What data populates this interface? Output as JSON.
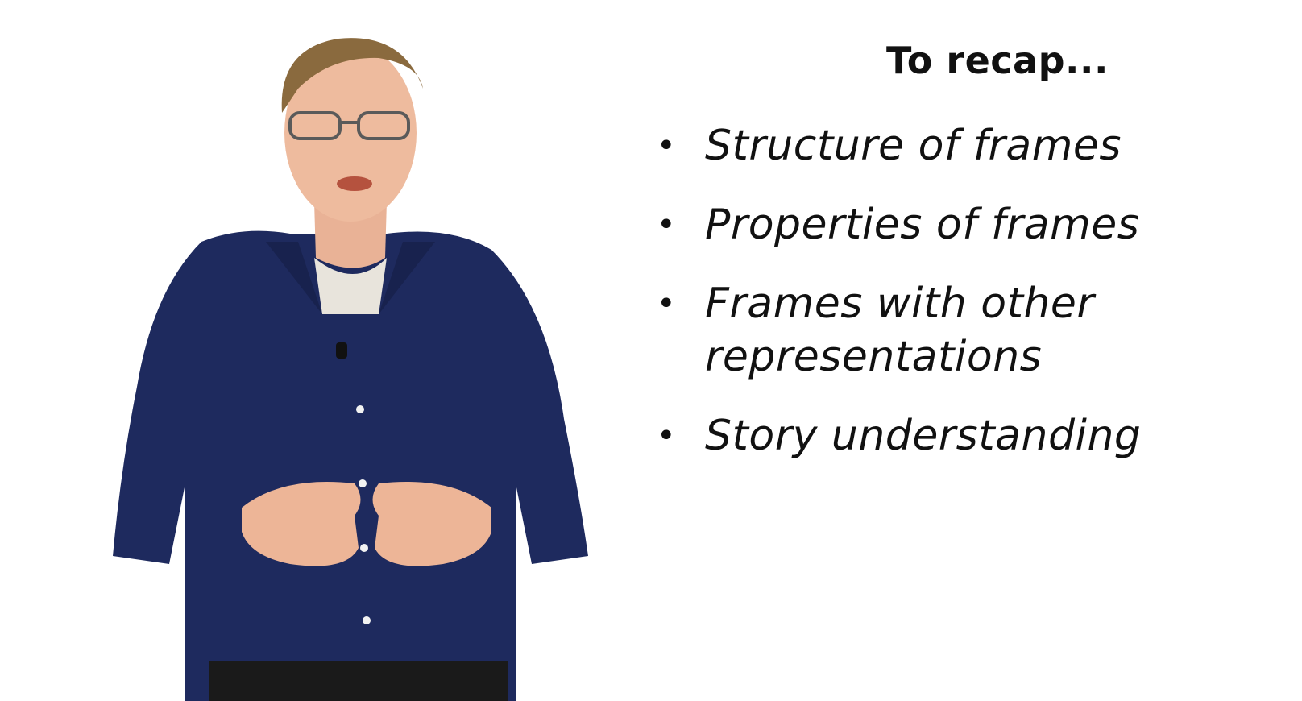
{
  "slide": {
    "title": "To recap...",
    "items": [
      "Structure of frames",
      "Properties of frames",
      "Frames with other representations",
      "Story understanding"
    ]
  },
  "presenter": {
    "shirt_color": "#1e2a5e",
    "background_color": "#ffffff"
  }
}
